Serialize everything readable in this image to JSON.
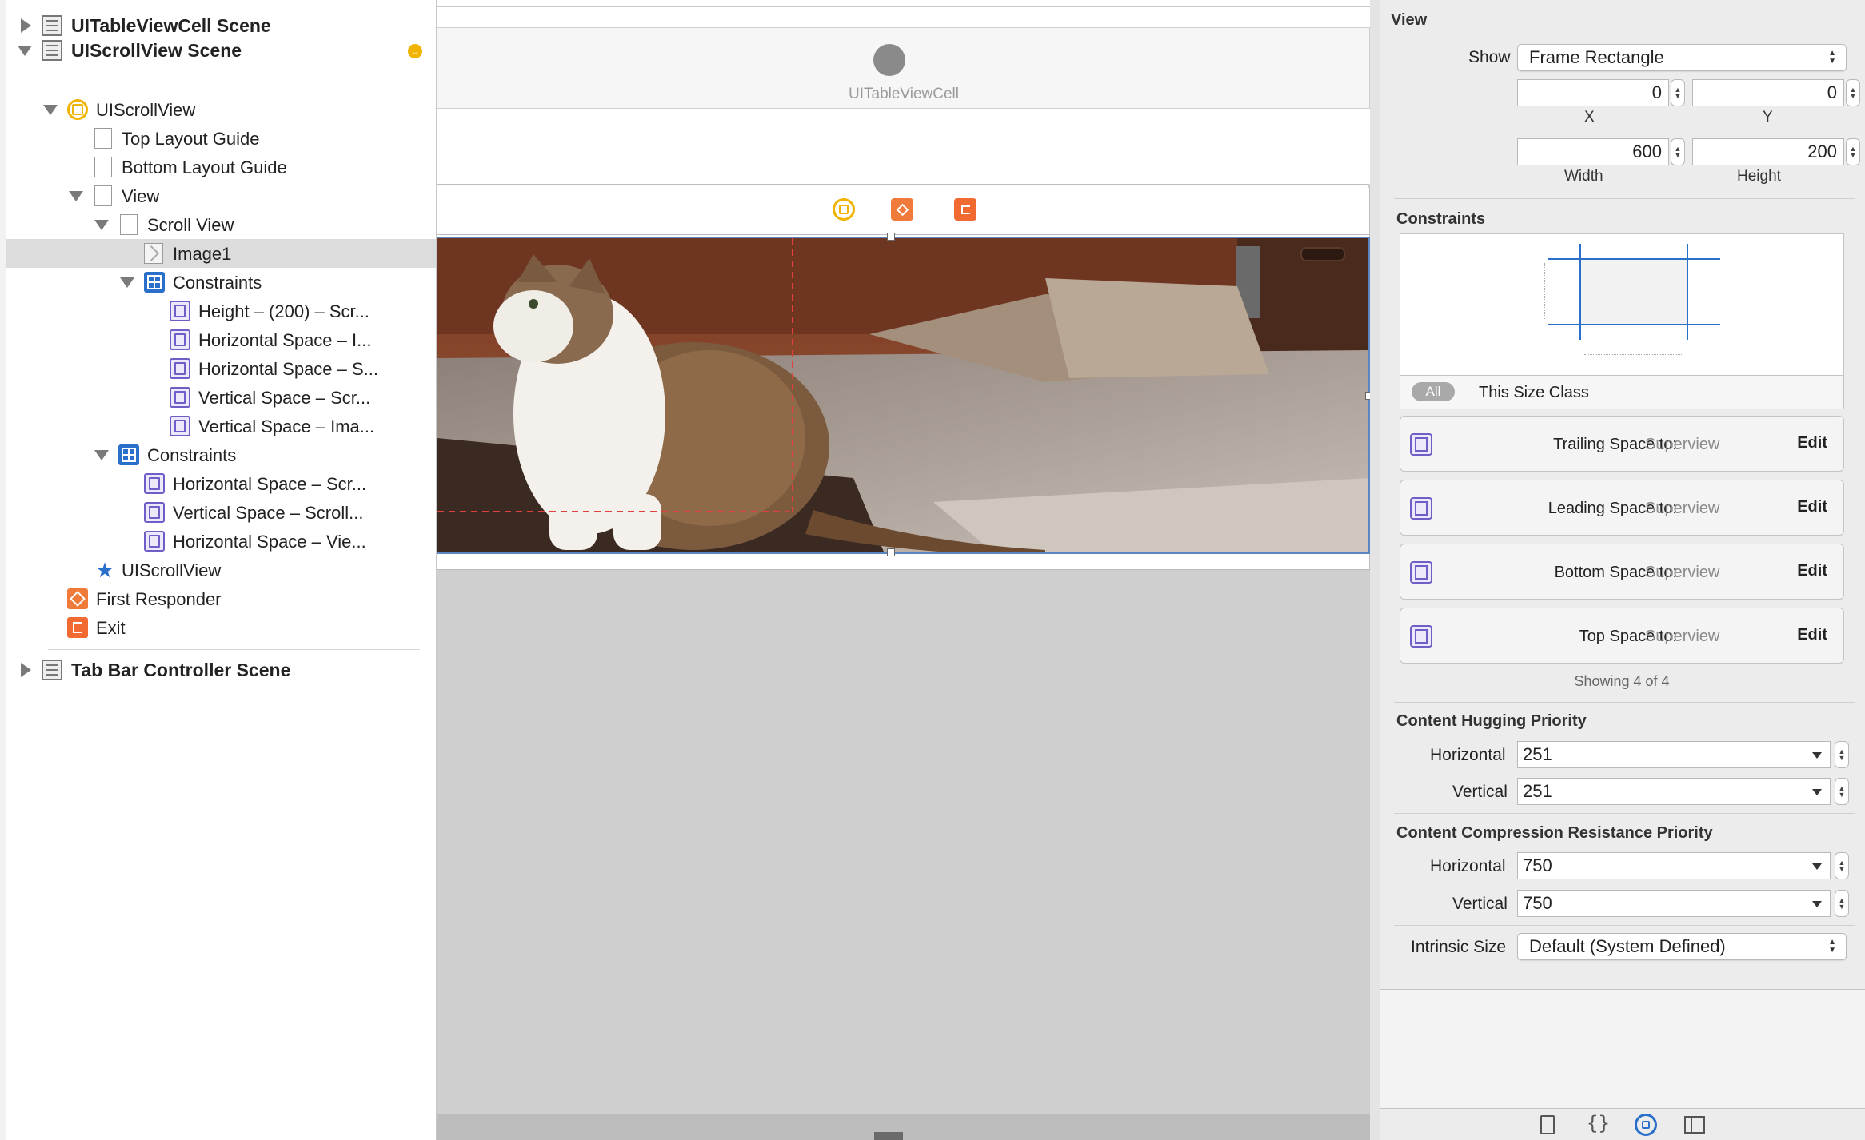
{
  "outline": {
    "rows": [
      {
        "label": "UITableViewCell Scene"
      },
      {
        "label": "UIScrollView Scene"
      },
      {
        "label": "UIScrollView"
      },
      {
        "label": "Top Layout Guide"
      },
      {
        "label": "Bottom Layout Guide"
      },
      {
        "label": "View"
      },
      {
        "label": "Scroll View"
      },
      {
        "label": "Image1"
      },
      {
        "label": "Constraints"
      },
      {
        "label": "Height – (200) – Scr..."
      },
      {
        "label": "Horizontal Space – I..."
      },
      {
        "label": "Horizontal Space – S..."
      },
      {
        "label": "Vertical Space – Scr..."
      },
      {
        "label": "Vertical Space – Ima..."
      },
      {
        "label": "Constraints"
      },
      {
        "label": "Horizontal Space – Scr..."
      },
      {
        "label": "Vertical Space – Scroll..."
      },
      {
        "label": "Horizontal Space – Vie..."
      },
      {
        "label": "UIScrollView"
      },
      {
        "label": "First Responder"
      },
      {
        "label": "Exit"
      },
      {
        "label": "Tab Bar Controller Scene"
      }
    ]
  },
  "canvas": {
    "cell_label": "UITableViewCell",
    "image_subject": "cat photo"
  },
  "inspector": {
    "section_title": "View",
    "show_label": "Show",
    "show_value": "Frame Rectangle",
    "x_value": "0",
    "y_value": "0",
    "x_label": "X",
    "y_label": "Y",
    "width_value": "600",
    "height_value": "200",
    "width_label": "Width",
    "height_label": "Height",
    "constraints_title": "Constraints",
    "all_label": "All",
    "size_class_label": "This Size Class",
    "constraint_cards": [
      {
        "label": "Trailing Space to:",
        "target": "Superview",
        "edit": "Edit"
      },
      {
        "label": "Leading Space to:",
        "target": "Superview",
        "edit": "Edit"
      },
      {
        "label": "Bottom Space to:",
        "target": "Superview",
        "edit": "Edit"
      },
      {
        "label": "Top Space to:",
        "target": "Superview",
        "edit": "Edit"
      }
    ],
    "showing_text": "Showing 4 of 4",
    "hugging_title": "Content Hugging Priority",
    "hugging_h_label": "Horizontal",
    "hugging_h_value": "251",
    "hugging_v_label": "Vertical",
    "hugging_v_value": "251",
    "compression_title": "Content Compression Resistance Priority",
    "compression_h_label": "Horizontal",
    "compression_h_value": "750",
    "compression_v_label": "Vertical",
    "compression_v_value": "750",
    "intrinsic_label": "Intrinsic Size",
    "intrinsic_value": "Default (System Defined)"
  },
  "icons": {
    "bottom_tabs": [
      "file-icon",
      "braces-icon",
      "attributes-icon",
      "size-ruler-icon"
    ]
  },
  "colors": {
    "accent": "#2a6fc9",
    "constraint": "#6f5ec8",
    "scene_dock_yellow": "#f0b400",
    "scene_dock_orange": "#f06a32",
    "selection": "#dcdcdc"
  }
}
